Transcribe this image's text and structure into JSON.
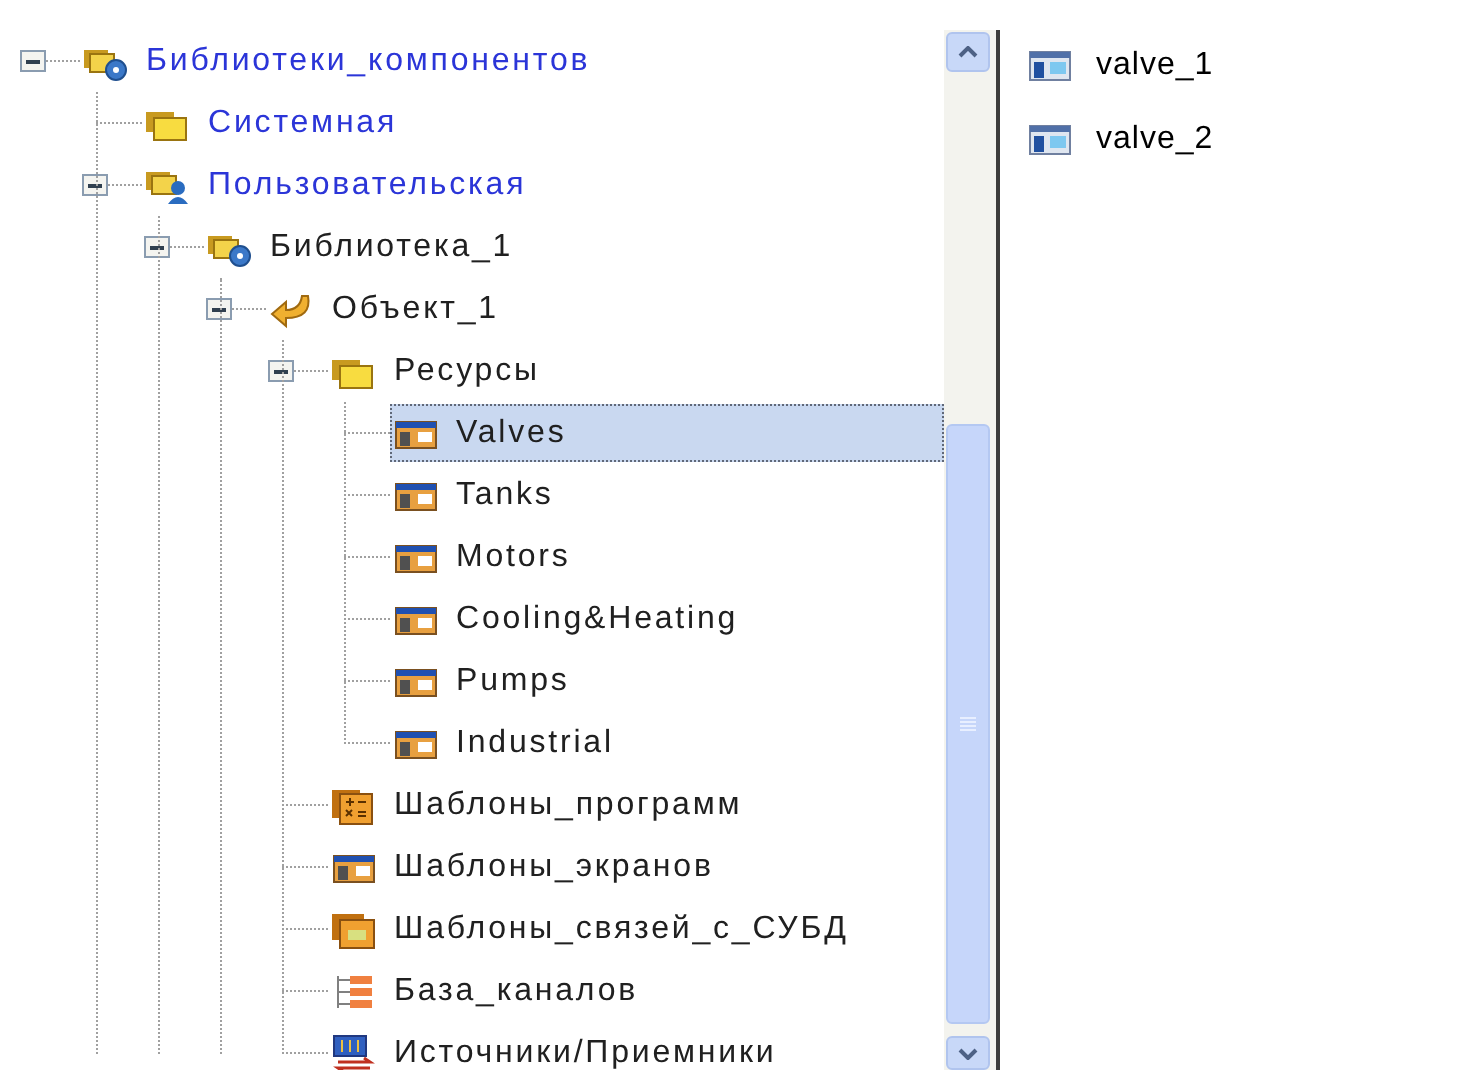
{
  "tree": [
    {
      "label": "Библиотеки_компонентов",
      "kind": "library",
      "link": true,
      "expanded": true,
      "selected": false,
      "children": [
        {
          "label": "Системная",
          "kind": "folder",
          "link": true,
          "selected": false
        },
        {
          "label": "Пользовательская",
          "kind": "user-library",
          "link": true,
          "expanded": true,
          "selected": false,
          "children": [
            {
              "label": "Библиотека_1",
              "kind": "library",
              "link": false,
              "expanded": true,
              "selected": false,
              "children": [
                {
                  "label": "Объект_1",
                  "kind": "object",
                  "link": false,
                  "expanded": true,
                  "selected": false,
                  "children": [
                    {
                      "label": "Ресурсы",
                      "kind": "folder",
                      "link": false,
                      "expanded": true,
                      "selected": false,
                      "children": [
                        {
                          "label": "Valves",
                          "kind": "screen",
                          "link": false,
                          "selected": true
                        },
                        {
                          "label": "Tanks",
                          "kind": "screen",
                          "link": false,
                          "selected": false
                        },
                        {
                          "label": "Motors",
                          "kind": "screen",
                          "link": false,
                          "selected": false
                        },
                        {
                          "label": "Cooling&Heating",
                          "kind": "screen",
                          "link": false,
                          "selected": false
                        },
                        {
                          "label": "Pumps",
                          "kind": "screen",
                          "link": false,
                          "selected": false
                        },
                        {
                          "label": "Industrial",
                          "kind": "screen",
                          "link": false,
                          "selected": false
                        }
                      ]
                    },
                    {
                      "label": "Шаблоны_программ",
                      "kind": "program",
                      "link": false,
                      "selected": false
                    },
                    {
                      "label": "Шаблоны_экранов",
                      "kind": "screen",
                      "link": false,
                      "selected": false
                    },
                    {
                      "label": "Шаблоны_связей_с_СУБД",
                      "kind": "database",
                      "link": false,
                      "selected": false
                    },
                    {
                      "label": "База_каналов",
                      "kind": "channels",
                      "link": false,
                      "selected": false
                    },
                    {
                      "label": "Источники/Приемники",
                      "kind": "sources",
                      "link": false,
                      "selected": false
                    }
                  ]
                }
              ]
            }
          ]
        }
      ]
    }
  ],
  "items": [
    {
      "label": "valve_1",
      "selected": false
    },
    {
      "label": "valve_2",
      "selected": false
    }
  ]
}
